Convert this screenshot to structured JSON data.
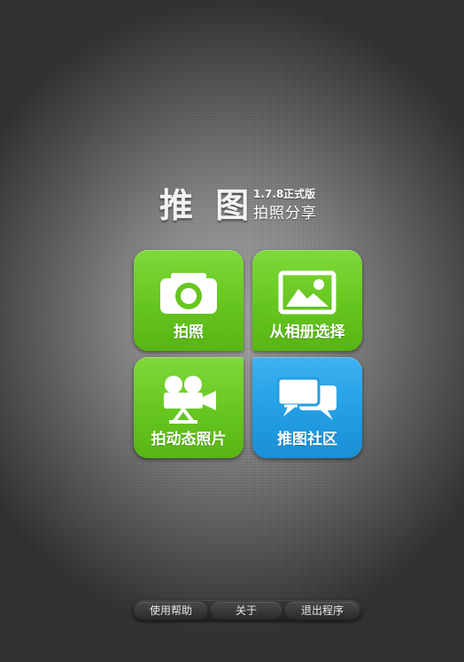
{
  "logo": {
    "title": "推 图",
    "version": "1.7.8正式版",
    "tagline": "拍照分享"
  },
  "tiles": [
    {
      "label": "拍照",
      "icon": "camera-icon",
      "color": "#66c61f"
    },
    {
      "label": "从相册选择",
      "icon": "image-icon",
      "color": "#66c61f"
    },
    {
      "label": "拍动态照片",
      "icon": "video-camera-icon",
      "color": "#66c61f"
    },
    {
      "label": "推图社区",
      "icon": "chat-bubbles-icon",
      "color": "#239ee3"
    }
  ],
  "bottom_bar": {
    "help": "使用帮助",
    "about": "关于",
    "exit": "退出程序"
  }
}
